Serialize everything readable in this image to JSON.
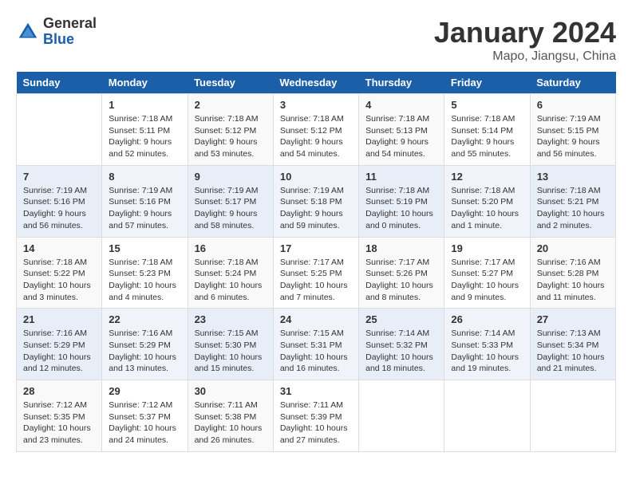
{
  "logo": {
    "general": "General",
    "blue": "Blue"
  },
  "title": "January 2024",
  "subtitle": "Mapo, Jiangsu, China",
  "days_of_week": [
    "Sunday",
    "Monday",
    "Tuesday",
    "Wednesday",
    "Thursday",
    "Friday",
    "Saturday"
  ],
  "weeks": [
    [
      {
        "day": "",
        "info": ""
      },
      {
        "day": "1",
        "info": "Sunrise: 7:18 AM\nSunset: 5:11 PM\nDaylight: 9 hours\nand 52 minutes."
      },
      {
        "day": "2",
        "info": "Sunrise: 7:18 AM\nSunset: 5:12 PM\nDaylight: 9 hours\nand 53 minutes."
      },
      {
        "day": "3",
        "info": "Sunrise: 7:18 AM\nSunset: 5:12 PM\nDaylight: 9 hours\nand 54 minutes."
      },
      {
        "day": "4",
        "info": "Sunrise: 7:18 AM\nSunset: 5:13 PM\nDaylight: 9 hours\nand 54 minutes."
      },
      {
        "day": "5",
        "info": "Sunrise: 7:18 AM\nSunset: 5:14 PM\nDaylight: 9 hours\nand 55 minutes."
      },
      {
        "day": "6",
        "info": "Sunrise: 7:19 AM\nSunset: 5:15 PM\nDaylight: 9 hours\nand 56 minutes."
      }
    ],
    [
      {
        "day": "7",
        "info": "Sunrise: 7:19 AM\nSunset: 5:16 PM\nDaylight: 9 hours\nand 56 minutes."
      },
      {
        "day": "8",
        "info": "Sunrise: 7:19 AM\nSunset: 5:16 PM\nDaylight: 9 hours\nand 57 minutes."
      },
      {
        "day": "9",
        "info": "Sunrise: 7:19 AM\nSunset: 5:17 PM\nDaylight: 9 hours\nand 58 minutes."
      },
      {
        "day": "10",
        "info": "Sunrise: 7:19 AM\nSunset: 5:18 PM\nDaylight: 9 hours\nand 59 minutes."
      },
      {
        "day": "11",
        "info": "Sunrise: 7:18 AM\nSunset: 5:19 PM\nDaylight: 10 hours\nand 0 minutes."
      },
      {
        "day": "12",
        "info": "Sunrise: 7:18 AM\nSunset: 5:20 PM\nDaylight: 10 hours\nand 1 minute."
      },
      {
        "day": "13",
        "info": "Sunrise: 7:18 AM\nSunset: 5:21 PM\nDaylight: 10 hours\nand 2 minutes."
      }
    ],
    [
      {
        "day": "14",
        "info": "Sunrise: 7:18 AM\nSunset: 5:22 PM\nDaylight: 10 hours\nand 3 minutes."
      },
      {
        "day": "15",
        "info": "Sunrise: 7:18 AM\nSunset: 5:23 PM\nDaylight: 10 hours\nand 4 minutes."
      },
      {
        "day": "16",
        "info": "Sunrise: 7:18 AM\nSunset: 5:24 PM\nDaylight: 10 hours\nand 6 minutes."
      },
      {
        "day": "17",
        "info": "Sunrise: 7:17 AM\nSunset: 5:25 PM\nDaylight: 10 hours\nand 7 minutes."
      },
      {
        "day": "18",
        "info": "Sunrise: 7:17 AM\nSunset: 5:26 PM\nDaylight: 10 hours\nand 8 minutes."
      },
      {
        "day": "19",
        "info": "Sunrise: 7:17 AM\nSunset: 5:27 PM\nDaylight: 10 hours\nand 9 minutes."
      },
      {
        "day": "20",
        "info": "Sunrise: 7:16 AM\nSunset: 5:28 PM\nDaylight: 10 hours\nand 11 minutes."
      }
    ],
    [
      {
        "day": "21",
        "info": "Sunrise: 7:16 AM\nSunset: 5:29 PM\nDaylight: 10 hours\nand 12 minutes."
      },
      {
        "day": "22",
        "info": "Sunrise: 7:16 AM\nSunset: 5:29 PM\nDaylight: 10 hours\nand 13 minutes."
      },
      {
        "day": "23",
        "info": "Sunrise: 7:15 AM\nSunset: 5:30 PM\nDaylight: 10 hours\nand 15 minutes."
      },
      {
        "day": "24",
        "info": "Sunrise: 7:15 AM\nSunset: 5:31 PM\nDaylight: 10 hours\nand 16 minutes."
      },
      {
        "day": "25",
        "info": "Sunrise: 7:14 AM\nSunset: 5:32 PM\nDaylight: 10 hours\nand 18 minutes."
      },
      {
        "day": "26",
        "info": "Sunrise: 7:14 AM\nSunset: 5:33 PM\nDaylight: 10 hours\nand 19 minutes."
      },
      {
        "day": "27",
        "info": "Sunrise: 7:13 AM\nSunset: 5:34 PM\nDaylight: 10 hours\nand 21 minutes."
      }
    ],
    [
      {
        "day": "28",
        "info": "Sunrise: 7:12 AM\nSunset: 5:35 PM\nDaylight: 10 hours\nand 23 minutes."
      },
      {
        "day": "29",
        "info": "Sunrise: 7:12 AM\nSunset: 5:37 PM\nDaylight: 10 hours\nand 24 minutes."
      },
      {
        "day": "30",
        "info": "Sunrise: 7:11 AM\nSunset: 5:38 PM\nDaylight: 10 hours\nand 26 minutes."
      },
      {
        "day": "31",
        "info": "Sunrise: 7:11 AM\nSunset: 5:39 PM\nDaylight: 10 hours\nand 27 minutes."
      },
      {
        "day": "",
        "info": ""
      },
      {
        "day": "",
        "info": ""
      },
      {
        "day": "",
        "info": ""
      }
    ]
  ]
}
